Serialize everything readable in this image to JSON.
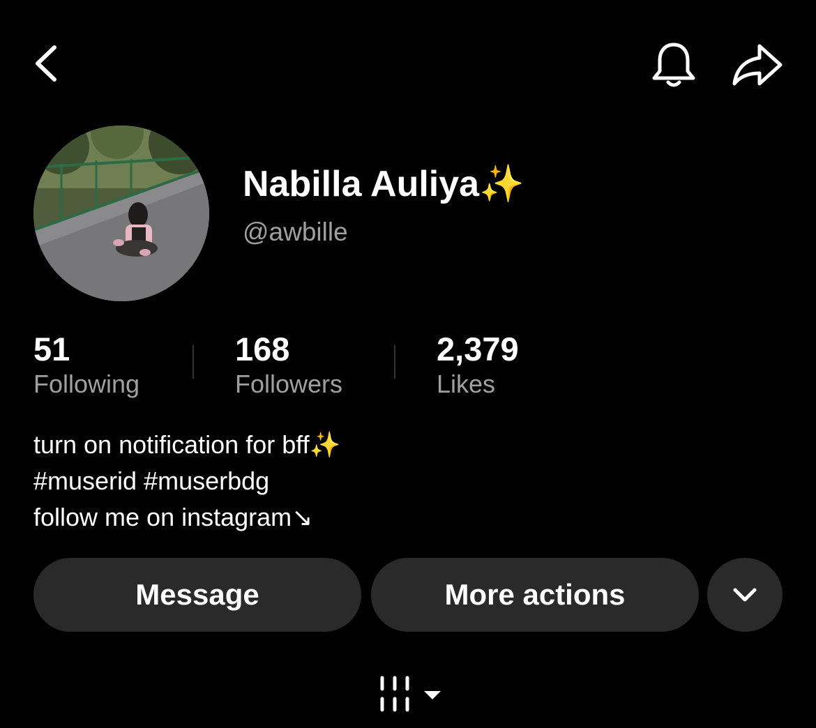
{
  "header": {
    "back_icon": "chevron-left-icon",
    "bell_icon": "bell-icon",
    "share_icon": "share-arrow-icon"
  },
  "profile": {
    "display_name": "Nabilla Auliya✨",
    "username": "@awbille",
    "avatar_icon": "profile-photo"
  },
  "stats": [
    {
      "value": "51",
      "label": "Following"
    },
    {
      "value": "168",
      "label": "Followers"
    },
    {
      "value": "2,379",
      "label": "Likes"
    }
  ],
  "bio": {
    "lines": [
      "turn on notification for bff✨",
      "#muserid #muserbdg",
      "follow me on instagram↘"
    ]
  },
  "actions": {
    "message_label": "Message",
    "more_actions_label": "More actions",
    "dropdown_icon": "chevron-down-icon"
  },
  "tabs": {
    "selector_icon": "grid-columns-icon"
  },
  "colors": {
    "background": "#000000",
    "text_primary": "#ffffff",
    "text_secondary": "#a0a0a0",
    "button_bg": "#2a2a2a"
  }
}
